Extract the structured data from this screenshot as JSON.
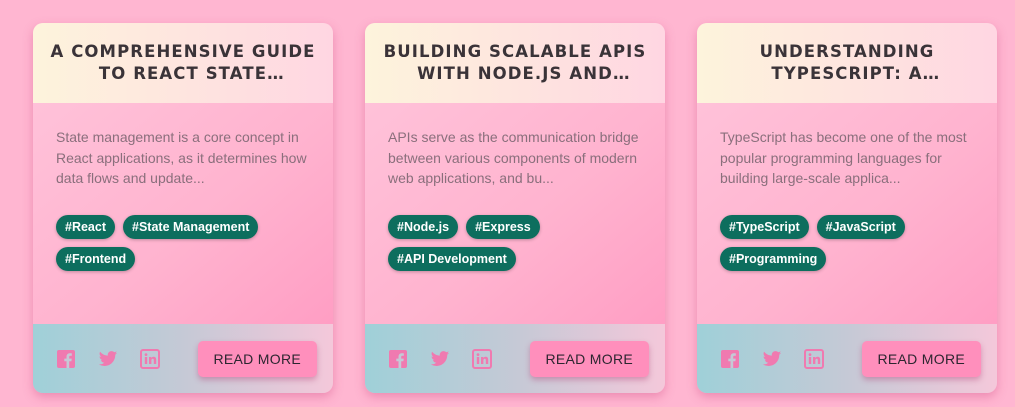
{
  "colors": {
    "page_background": "#ffb6d1",
    "tag_background": "#0d6e5e",
    "button_background": "#ff8fbc",
    "social_icon": "#f07ab0"
  },
  "cards": [
    {
      "title": "A COMPREHENSIVE GUIDE TO REACT STATE MANAGEMENT",
      "excerpt": "State management is a core concept in React applications, as it determines how data flows and update...",
      "tags": [
        "#React",
        "#State Management",
        "#Frontend"
      ],
      "social_icons": [
        "facebook-icon",
        "twitter-icon",
        "linkedin-icon"
      ],
      "read_more_label": "READ MORE"
    },
    {
      "title": "BUILDING SCALABLE APIS WITH NODE.JS AND EXPRESS",
      "excerpt": "APIs serve as the communication bridge between various components of modern web applications, and bu...",
      "tags": [
        "#Node.js",
        "#Express",
        "#API Development"
      ],
      "social_icons": [
        "facebook-icon",
        "twitter-icon",
        "linkedin-icon"
      ],
      "read_more_label": "READ MORE"
    },
    {
      "title": "UNDERSTANDING TYPESCRIPT: A BEGINNER’S GUIDE",
      "excerpt": "TypeScript has become one of the most popular programming languages for building large-scale applica...",
      "tags": [
        "#TypeScript",
        "#JavaScript",
        "#Programming"
      ],
      "social_icons": [
        "facebook-icon",
        "twitter-icon",
        "linkedin-icon"
      ],
      "read_more_label": "READ MORE"
    }
  ]
}
